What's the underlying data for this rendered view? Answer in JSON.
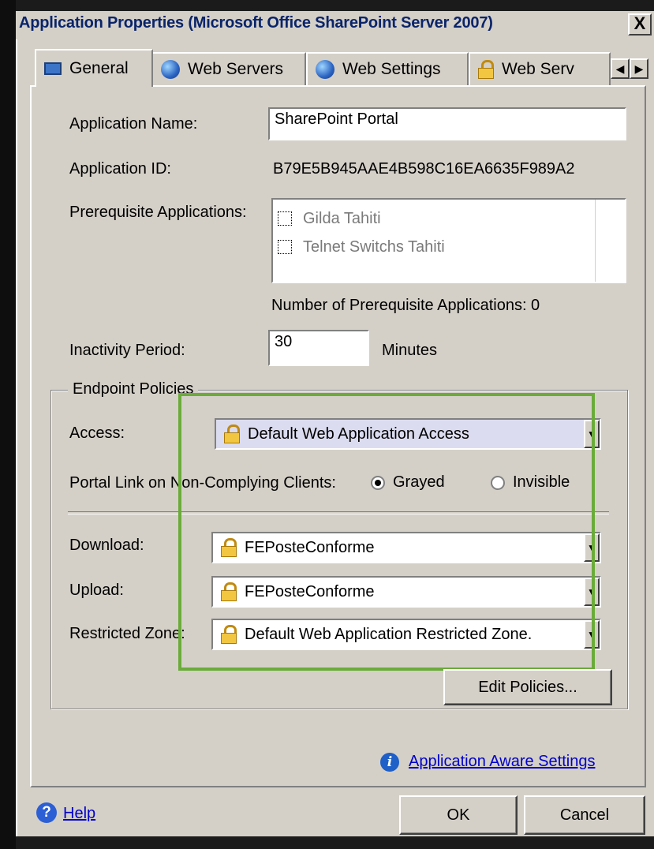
{
  "window": {
    "title": "Application Properties (Microsoft Office SharePoint Server 2007)",
    "close_glyph": "X"
  },
  "tabs": [
    {
      "label": "General",
      "icon": "monitor-icon",
      "active": true
    },
    {
      "label": "Web Servers",
      "icon": "globe-icon"
    },
    {
      "label": "Web Settings",
      "icon": "globe-icon"
    },
    {
      "label": "Web Serv",
      "icon": "lock-icon"
    }
  ],
  "tab_scroll": {
    "left": "◀",
    "right": "▶"
  },
  "general": {
    "app_name_label": "Application Name:",
    "app_name_value": "SharePoint Portal",
    "app_id_label": "Application ID:",
    "app_id_value": "B79E5B945AAE4B598C16EA6635F989A2",
    "prereq_label": "Prerequisite Applications:",
    "prereq_items": [
      {
        "label": "Gilda Tahiti",
        "checked": false
      },
      {
        "label": "Telnet Switchs Tahiti",
        "checked": false
      }
    ],
    "prereq_count_text": "Number of Prerequisite Applications: 0",
    "inactivity_label": "Inactivity Period:",
    "inactivity_value": "30",
    "inactivity_unit": "Minutes"
  },
  "endpoint": {
    "legend": "Endpoint Policies",
    "access_label": "Access:",
    "access_value": "Default Web Application Access",
    "portal_link_label": "Portal Link on Non-Complying Clients:",
    "radio_grayed": "Grayed",
    "radio_invisible": "Invisible",
    "selected_radio": "Grayed",
    "download_label": "Download:",
    "download_value": "FEPosteConforme",
    "upload_label": "Upload:",
    "upload_value": "FEPosteConforme",
    "restricted_label": "Restricted Zone:",
    "restricted_value": "Default Web Application Restricted Zone.",
    "edit_policies": "Edit Policies..."
  },
  "footer": {
    "app_aware_link": "Application Aware Settings",
    "help_link": "Help",
    "ok": "OK",
    "cancel": "Cancel"
  },
  "colors": {
    "dialog_bg": "#d4d0c8",
    "title_text": "#0a246a",
    "link": "#0000cc",
    "highlight_border": "#6aab3a"
  }
}
